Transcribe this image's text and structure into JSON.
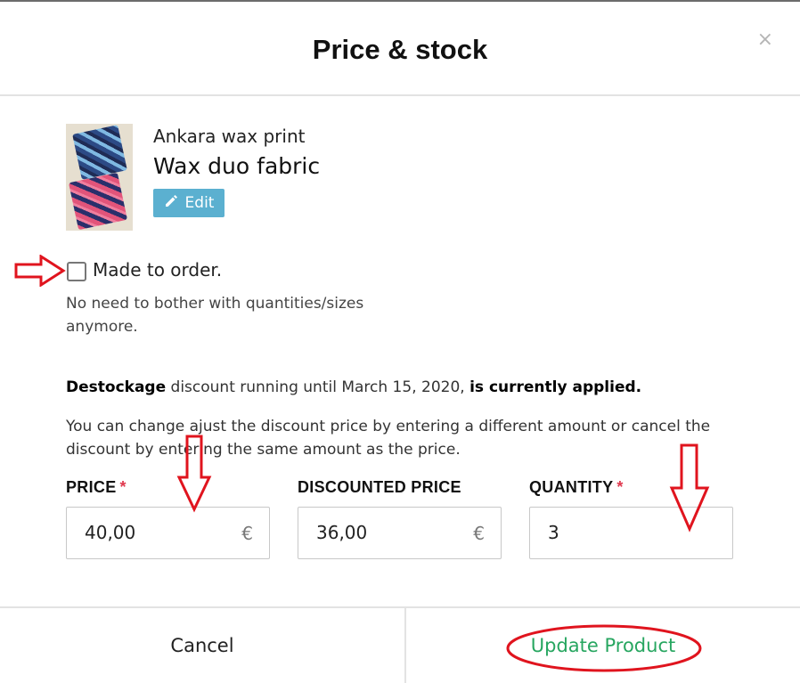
{
  "modal": {
    "title": "Price & stock",
    "close_symbol": "×"
  },
  "product": {
    "category": "Ankara wax print",
    "name": "Wax duo fabric",
    "edit_label": "Edit"
  },
  "made_to_order": {
    "label": "Made to order.",
    "help": "No need to bother with quantities/sizes anymore.",
    "checked": false
  },
  "discount": {
    "name": "Destockage",
    "running_text": " discount running until March 15, 2020, ",
    "status": "is currently applied.",
    "help": "You can change ajust the discount price by entering a different amount or cancel the discount by entering the same amount as the price."
  },
  "fields": {
    "price": {
      "label": "PRICE",
      "required": "*",
      "value": "40,00",
      "currency": "€"
    },
    "discounted_price": {
      "label": "DISCOUNTED PRICE",
      "value": "36,00",
      "currency": "€"
    },
    "quantity": {
      "label": "QUANTITY",
      "required": "*",
      "value": "3"
    }
  },
  "footer": {
    "cancel_label": "Cancel",
    "update_label": "Update Product"
  },
  "colors": {
    "annotation_red": "#e0141e",
    "update_green": "#27a660",
    "edit_blue": "#5bb0d0",
    "required_red": "#e0394e"
  }
}
